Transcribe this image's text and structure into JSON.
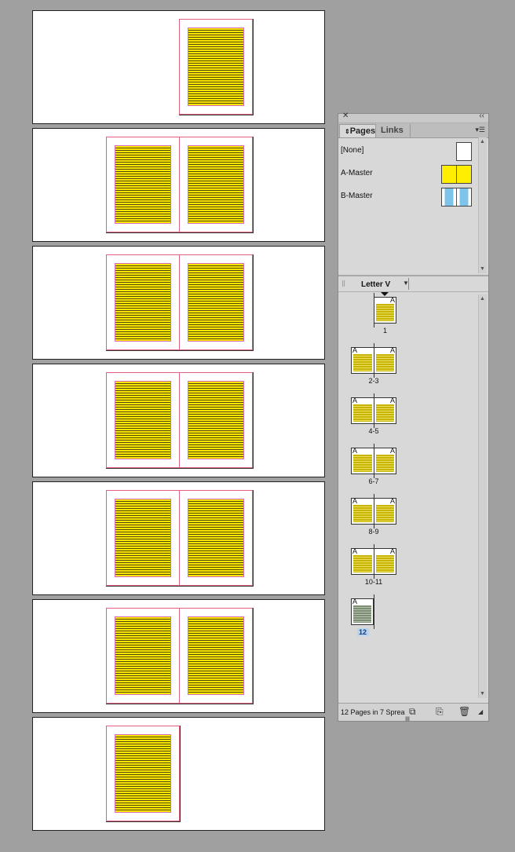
{
  "panel": {
    "close_icon": "close-icon",
    "collapse_icon": "double-chevron-icon",
    "tabs": [
      {
        "label": "Pages",
        "active": true
      },
      {
        "label": "Links",
        "active": false
      }
    ],
    "masters": [
      {
        "label": "[None]",
        "color": "#ffffff"
      },
      {
        "label": "A-Master",
        "color": "#ffee00"
      },
      {
        "label": "B-Master",
        "color": "#7ec4ea"
      }
    ],
    "page_size": "Letter V",
    "spreads": [
      {
        "label": "1"
      },
      {
        "label": "2-3"
      },
      {
        "label": "4-5"
      },
      {
        "label": "6-7"
      },
      {
        "label": "8-9"
      },
      {
        "label": "10-11"
      },
      {
        "label": "12",
        "selected": true
      }
    ],
    "master_prefix": "A",
    "status": "12 Pages in 7 Sprea",
    "colors": {
      "text_frame": "#ffe600",
      "margin_guide": "#d36db8",
      "selection": "#b8d4f0"
    }
  }
}
